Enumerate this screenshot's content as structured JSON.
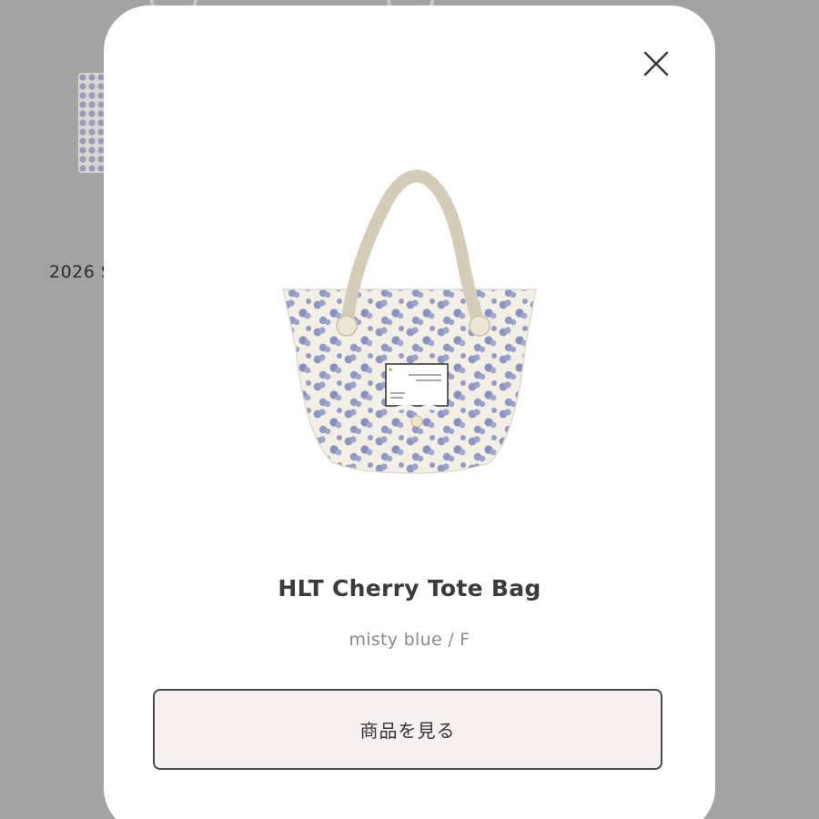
{
  "background_page": {
    "caption": "2026 S"
  },
  "modal": {
    "close_icon": "close-icon",
    "product": {
      "image_description": "cherry-print-tote-bag-image",
      "name": "HLT Cherry Tote Bag",
      "variant": "misty blue / F"
    },
    "view_button_label": "商品を見る"
  },
  "colors": {
    "overlay": "#8d8d8d",
    "modal_bg": "#ffffff",
    "button_bg": "#f6f0f0",
    "button_border": "#4a4a4a",
    "title_text": "#3b3b3b",
    "variant_text": "#8a8a8a",
    "print_blue": "#8c95c4",
    "canvas": "#f3efe4",
    "rope": "#ebe4d2"
  }
}
